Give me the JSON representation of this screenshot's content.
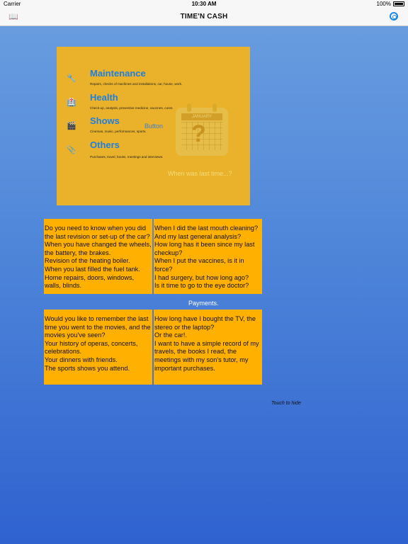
{
  "status": {
    "carrier": "Carrier",
    "time": "10:30 AM",
    "battery": "100%"
  },
  "nav": {
    "title": "TIME'N CASH",
    "left_icon": "book-icon",
    "right_icon": "spiral-icon"
  },
  "panel": {
    "categories": [
      {
        "title": "Maintenance",
        "desc": "Repairs, checks of machines and installations, car, house, work.",
        "icon": "wrench-icon"
      },
      {
        "title": "Health",
        "desc": "Check-up, analysis, preventive medicine, vaccines, cures.",
        "icon": "medical-kit-icon"
      },
      {
        "title": "Shows",
        "desc": "Cinemas, music, performances, sports.",
        "icon": "clapperboard-icon"
      },
      {
        "title": "Others",
        "desc": "Purchases, travel, books, meetings and interviews.",
        "icon": "paperclip-icon"
      }
    ],
    "button_label": "Button",
    "calendar_month": "JANUARY",
    "tagline": "When was last time...?"
  },
  "cards": {
    "maintenance": "Do you need to know when you did the last revision or set-up of the car?\nWhen you have changed the wheels, the battery, the brakes.\nRevision of the heating boiler.\nWhen you last filled the fuel tank.\nHome repairs, doors, windows, walls, blinds.",
    "health": "When I did the last mouth cleaning?\nAnd my last general analysis?\nHow long has it been since my last checkup?\nWhen I put the vaccines, is it in force?\nI had surgery, but how long ago?\nIs it time to go to the eye doctor?",
    "shows": "Would you like to remember the last time you went to the movies, and the movies you've seen?\nYour history of operas, concerts, celebrations.\nYour dinners with friends.\nThe sports shows you attend.",
    "others": "How long have I bought the TV, the stereo or the laptop?\nOr the car!.\nI want to have a simple record of my travels, the books I read, the meetings with my son's tutor, my important purchases."
  },
  "payments_label": "Payments.",
  "touch_label": "Touch to hide"
}
